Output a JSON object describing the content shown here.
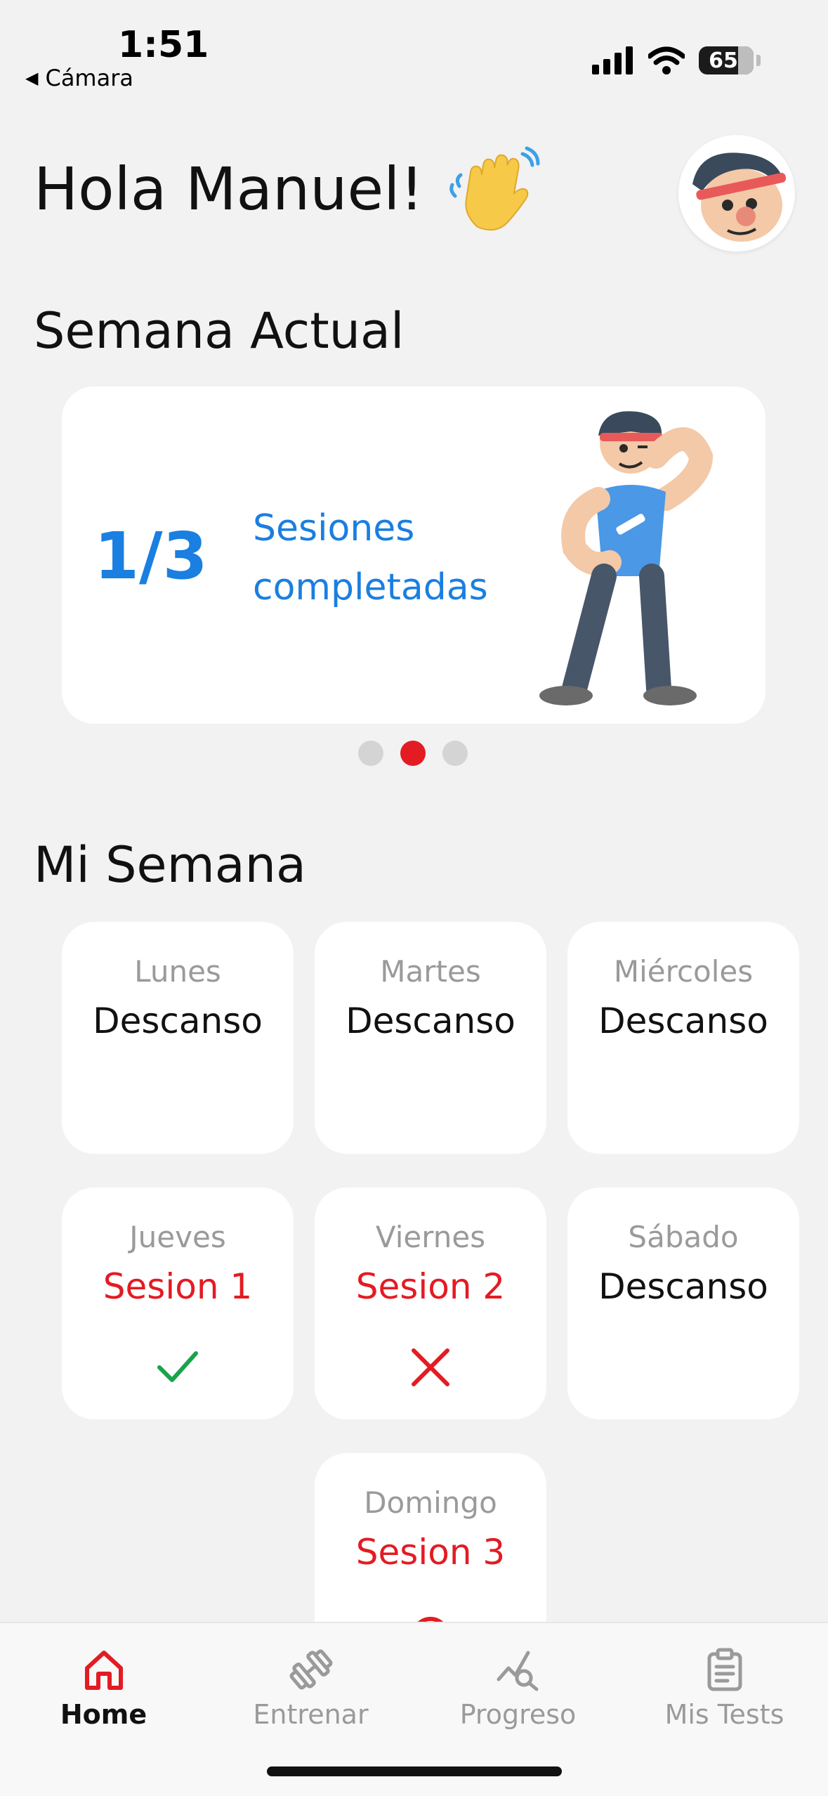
{
  "status_bar": {
    "time": "1:51",
    "back_label": "Cámara",
    "battery": "65"
  },
  "header": {
    "greeting": "Hola Manuel!",
    "wave_icon": "waving-hand-icon",
    "avatar_icon": "cartoon-avatar"
  },
  "current_week": {
    "title": "Semana Actual",
    "count": "1/3",
    "label": "Sesiones completadas",
    "carousel_active_index": 1,
    "carousel_pages": 3
  },
  "my_week": {
    "title": "Mi Semana",
    "days": [
      {
        "name": "Lunes",
        "status": "Descanso"
      },
      {
        "name": "Martes",
        "status": "Descanso"
      },
      {
        "name": "Miércoles",
        "status": "Descanso"
      },
      {
        "name": "Jueves",
        "status": "Sesion 1",
        "mark": "check-icon"
      },
      {
        "name": "Viernes",
        "status": "Sesion 2",
        "mark": "cross-icon"
      },
      {
        "name": "Sábado",
        "status": "Descanso"
      },
      {
        "name": "Domingo",
        "status": "Sesion 3",
        "mark": "pending-icon"
      }
    ]
  },
  "nav": {
    "items": [
      {
        "label": "Home",
        "icon": "home-icon",
        "active": true
      },
      {
        "label": "Entrenar",
        "icon": "dumbbell-icon",
        "active": false
      },
      {
        "label": "Progreso",
        "icon": "progress-chart-icon",
        "active": false
      },
      {
        "label": "Mis Tests",
        "icon": "clipboard-icon",
        "active": false
      }
    ]
  },
  "colors": {
    "accent_red": "#e31b23",
    "accent_blue": "#1a7fe0",
    "success_green": "#1aa34a"
  }
}
